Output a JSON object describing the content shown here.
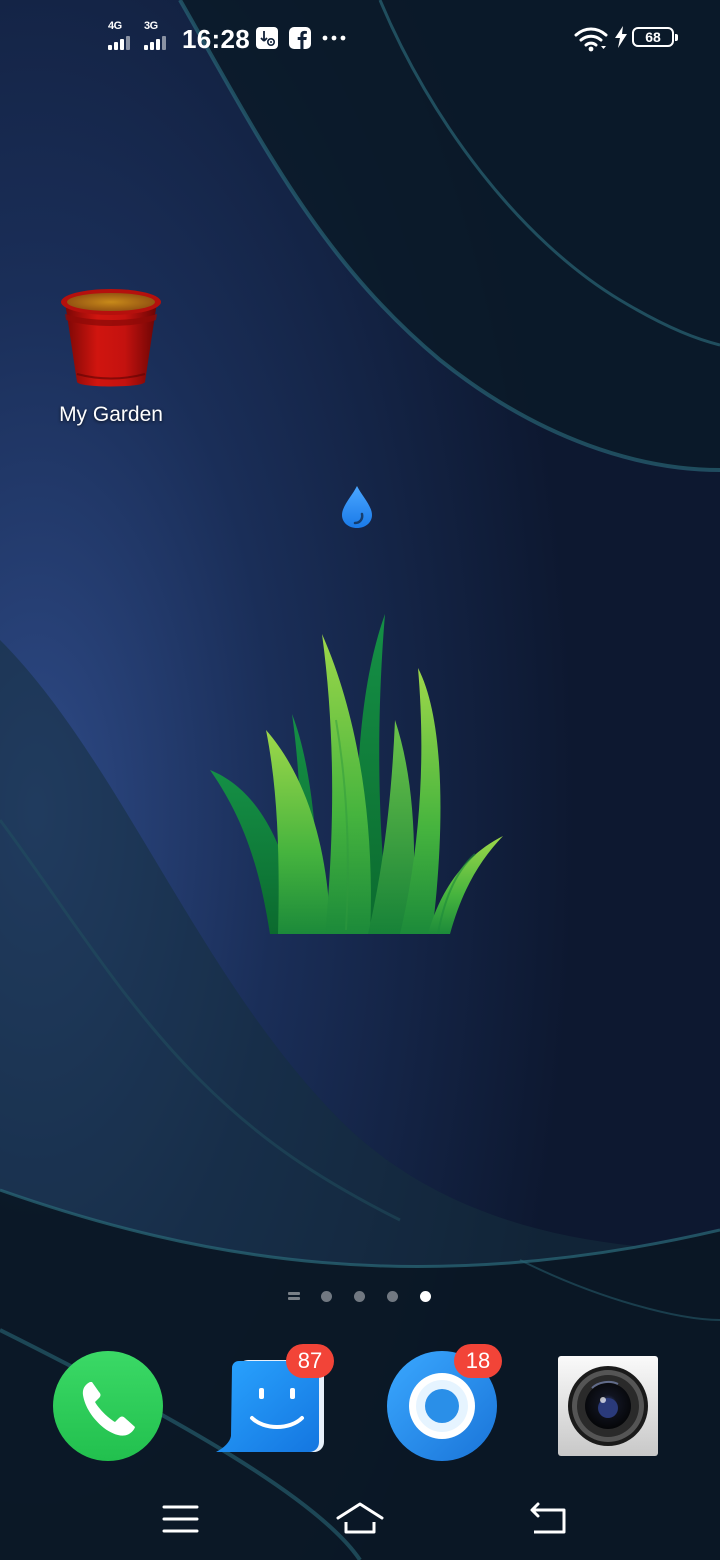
{
  "status_bar": {
    "network_1": "4G",
    "network_2": "3G",
    "time": "16:28",
    "battery_level": "68",
    "icons": [
      "signal-icon",
      "usb-debug-icon",
      "facebook-icon",
      "more-notifications-icon",
      "wifi-icon",
      "charging-icon",
      "battery-icon"
    ]
  },
  "home": {
    "apps": [
      {
        "label": "My Garden",
        "icon": "garden-pot-icon"
      }
    ],
    "widget": {
      "icons": [
        "water-drop-icon",
        "grass-icon"
      ]
    }
  },
  "page_indicator": {
    "pages": 4,
    "active_page": 4
  },
  "dock": {
    "apps": [
      {
        "icon": "phone-icon"
      },
      {
        "icon": "messages-icon",
        "badge": "87"
      },
      {
        "icon": "browser-icon",
        "badge": "18"
      },
      {
        "icon": "camera-icon"
      }
    ]
  },
  "nav_bar": {
    "buttons": [
      "menu-icon",
      "home-icon",
      "back-icon"
    ]
  },
  "colors": {
    "badge": "#f24438",
    "phone": "#2fce5a",
    "messages": "#1d8df0",
    "browser": "#2a8fe8",
    "pot": "#c4120f",
    "grass": "#3aa83e"
  }
}
